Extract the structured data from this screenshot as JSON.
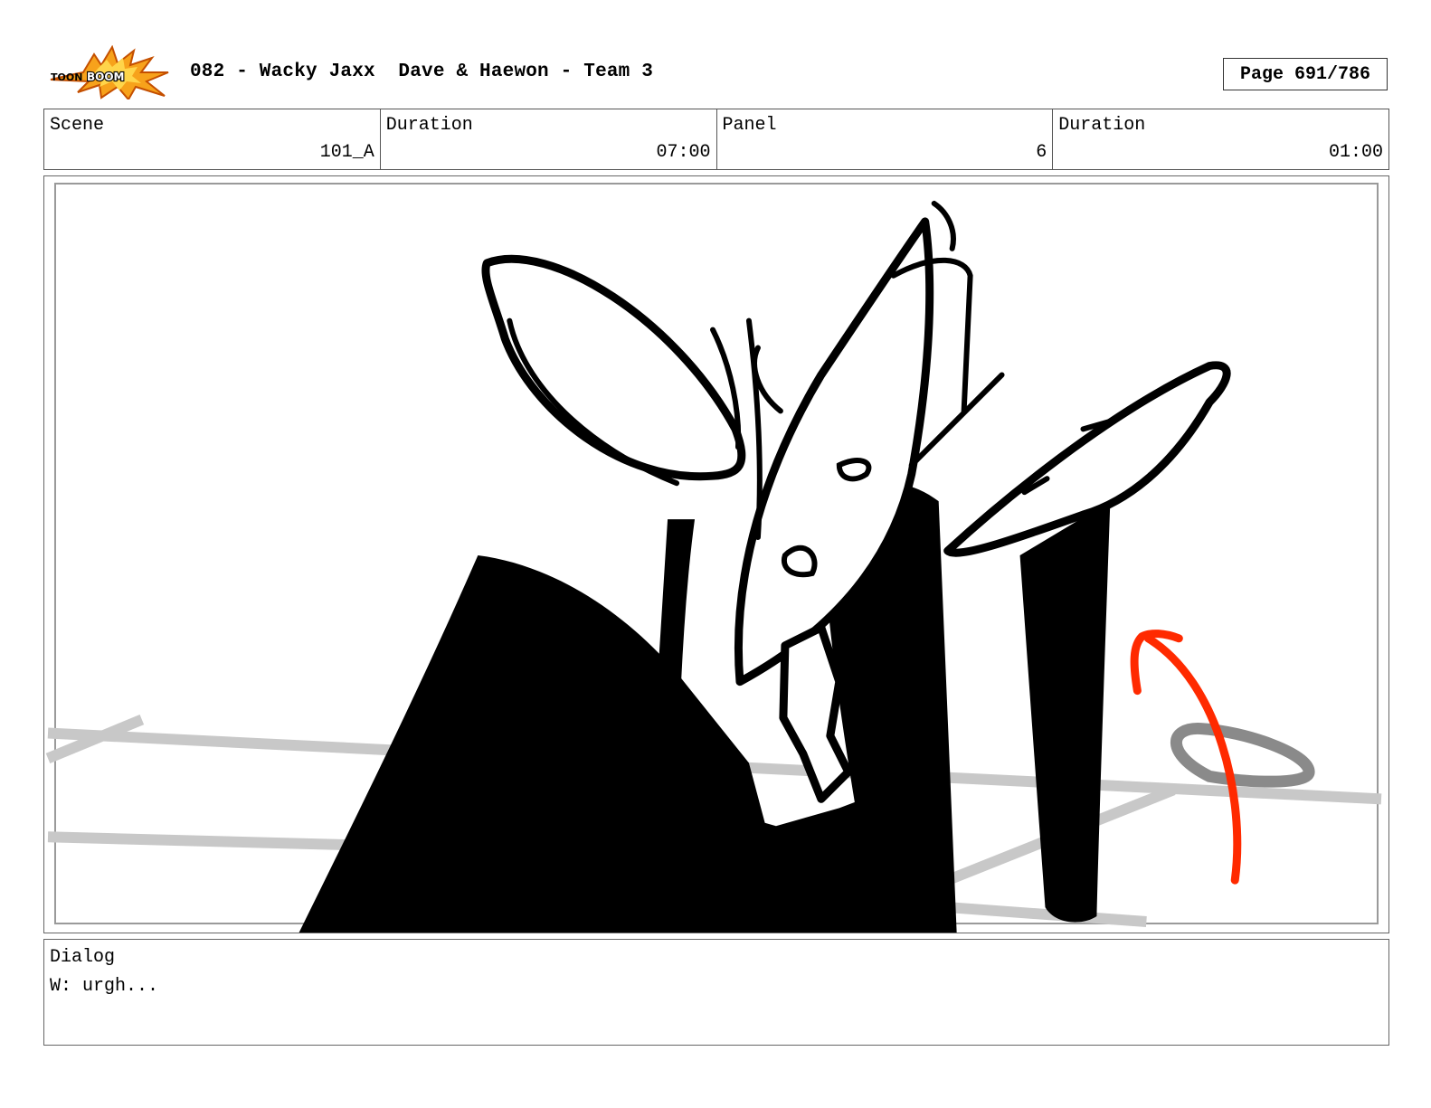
{
  "header": {
    "logo_name": "toon-boom-logo",
    "logo_text": "TOON BOOM",
    "title": "082 - Wacky Jaxx  Dave & Haewon - Team 3",
    "page": "Page 691/786"
  },
  "info": {
    "scene_label": "Scene",
    "scene_value": "101_A",
    "duration_label": "Duration",
    "duration_value": "07:00",
    "panel_label": "Panel",
    "panel_value": "6",
    "panel_duration_label": "Duration",
    "panel_duration_value": "01:00"
  },
  "panel": {
    "description_icon": "storyboard-drawing",
    "arrow_color": "#ff2a00",
    "guide_color": "#c8c8c8"
  },
  "dialog": {
    "label": "Dialog",
    "text": "W: urgh..."
  }
}
